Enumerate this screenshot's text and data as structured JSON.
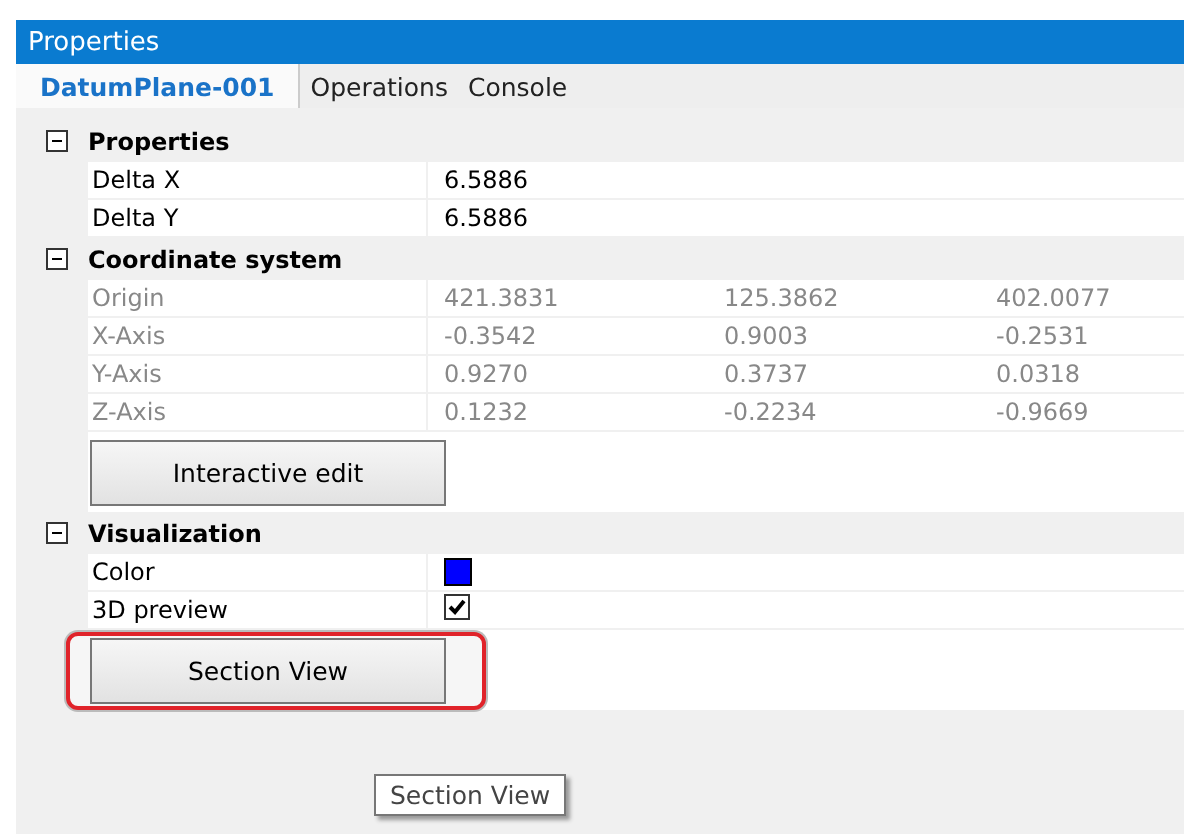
{
  "window": {
    "title": "Properties"
  },
  "tabs": [
    {
      "label": "DatumPlane-001",
      "selected": true
    },
    {
      "label": "Operations",
      "selected": false
    },
    {
      "label": "Console",
      "selected": false
    }
  ],
  "sections": [
    {
      "title": "Properties",
      "expanded": true,
      "rows": [
        {
          "kind": "values",
          "label": "Delta X",
          "disabled": false,
          "values": [
            "6.5886"
          ]
        },
        {
          "kind": "values",
          "label": "Delta Y",
          "disabled": false,
          "values": [
            "6.5886"
          ]
        }
      ]
    },
    {
      "title": "Coordinate system",
      "expanded": true,
      "rows": [
        {
          "kind": "values",
          "label": "Origin",
          "disabled": true,
          "values": [
            "421.3831",
            "125.3862",
            "402.0077"
          ]
        },
        {
          "kind": "values",
          "label": "X-Axis",
          "disabled": true,
          "values": [
            "-0.3542",
            "0.9003",
            "-0.2531"
          ]
        },
        {
          "kind": "values",
          "label": "Y-Axis",
          "disabled": true,
          "values": [
            "0.9270",
            "0.3737",
            "0.0318"
          ]
        },
        {
          "kind": "values",
          "label": "Z-Axis",
          "disabled": true,
          "values": [
            "0.1232",
            "-0.2234",
            "-0.9669"
          ]
        }
      ],
      "button": {
        "label": "Interactive edit",
        "highlighted": false
      }
    },
    {
      "title": "Visualization",
      "expanded": true,
      "rows": [
        {
          "kind": "color",
          "label": "Color",
          "disabled": false,
          "color": "#0000ff"
        },
        {
          "kind": "checkbox",
          "label": "3D preview",
          "disabled": false,
          "checked": true
        }
      ],
      "button": {
        "label": "Section View",
        "highlighted": true
      }
    }
  ],
  "tooltip": "Section View"
}
